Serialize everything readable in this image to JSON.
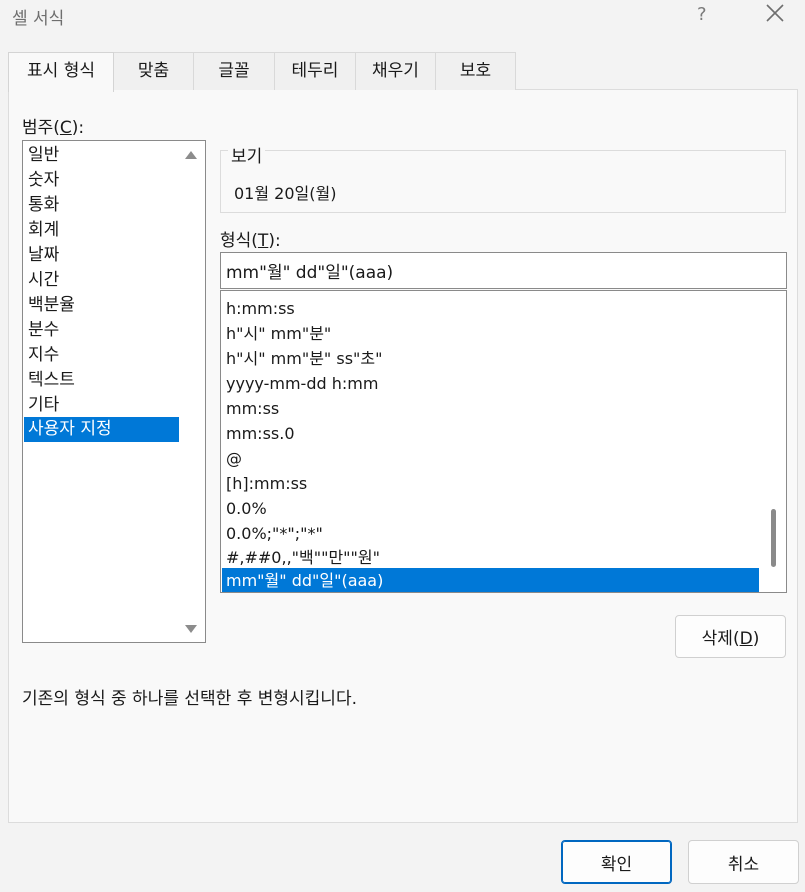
{
  "window": {
    "title": "셀 서식",
    "help_glyph": "?",
    "close_glyph": "✕"
  },
  "tabs": [
    {
      "label": "표시 형식",
      "active": true
    },
    {
      "label": "맞춤",
      "active": false
    },
    {
      "label": "글꼴",
      "active": false
    },
    {
      "label": "테두리",
      "active": false
    },
    {
      "label": "채우기",
      "active": false
    },
    {
      "label": "보호",
      "active": false
    }
  ],
  "category": {
    "label_prefix": "범주(",
    "label_key": "C",
    "label_suffix": "):",
    "items": [
      "일반",
      "숫자",
      "통화",
      "회계",
      "날짜",
      "시간",
      "백분율",
      "분수",
      "지수",
      "텍스트",
      "기타",
      "사용자 지정"
    ],
    "selected_index": 11
  },
  "preview": {
    "label": "보기",
    "value": "01월 20일(월)"
  },
  "format": {
    "label_prefix": "형식(",
    "label_key": "T",
    "label_suffix": "):",
    "input_value": "mm\"월\" dd\"일\"(aaa)",
    "items": [
      "h:mm:ss",
      "h\"시\" mm\"분\"",
      "h\"시\" mm\"분\" ss\"초\"",
      "yyyy-mm-dd h:mm",
      "mm:ss",
      "mm:ss.0",
      "@",
      "[h]:mm:ss",
      "0.0%",
      "0.0%;\"*\";\"*\"",
      "#,##0,,\"백\"\"만\"\"원\"",
      "mm\"월\" dd\"일\"(aaa)"
    ],
    "selected_index": 11
  },
  "delete_button": {
    "label_prefix": "삭제(",
    "label_key": "D",
    "label_suffix": ")"
  },
  "description": "기존의 형식 중 하나를 선택한 후 변형시킵니다.",
  "footer": {
    "ok_label": "확인",
    "cancel_label": "취소"
  },
  "colors": {
    "selection": "#0078d7",
    "primary_border": "#0067c0"
  }
}
